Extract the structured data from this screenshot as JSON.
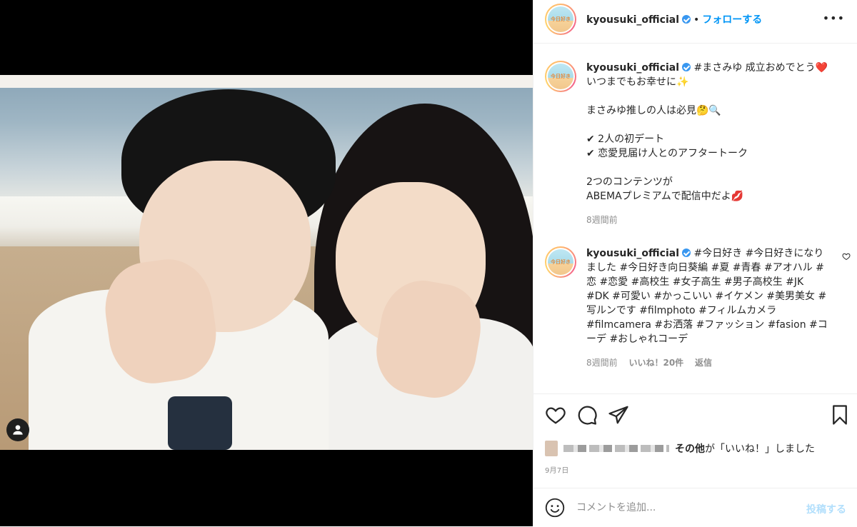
{
  "header": {
    "username": "kyousuki_official",
    "dot": "•",
    "follow_label": "フォローする",
    "more": "•••",
    "avatar_text": "今日好き"
  },
  "caption": {
    "username": "kyousuki_official",
    "lines": [
      "#まさみゆ 成立おめでとう❤️",
      "いつまでもお幸せに✨",
      "",
      "まさみゆ推しの人は必見🤔🔍",
      "",
      "✔︎ 2人の初デート",
      "✔︎ 恋愛見届け人とのアフタートーク",
      "",
      "2つのコンテンツが",
      "ABEMAプレミアムで配信中だよ💋"
    ],
    "time": "8週間前"
  },
  "hashtag_comment": {
    "username": "kyousuki_official",
    "text": "#今日好き #今日好きになりました #今日好き向日葵編 #夏 #青春 #アオハル #恋 #恋愛 #高校生 #女子高生 #男子高校生 #JK #DK #可愛い #かっこいい #イケメン #美男美女 #写ルンです #filmphoto #フィルムカメラ #filmcamera #お洒落 #ファッション #fasion #コーデ #おしゃれコーデ",
    "time": "8週間前",
    "likes": "いいね！20件",
    "reply": "返信"
  },
  "likes_line": {
    "bold": "その他",
    "rest": "が「いいね！」しました"
  },
  "date": "9月7日",
  "comment_box": {
    "placeholder": "コメントを追加...",
    "post_label": "投稿する"
  },
  "icons": {
    "like": "heart-icon",
    "comment": "comment-icon",
    "share": "share-icon",
    "save": "bookmark-icon",
    "emoji": "emoji-icon",
    "user_tag": "user-icon"
  },
  "colors": {
    "accent": "#0095f6",
    "verified": "#3897f0",
    "muted": "#8e8e8e",
    "post_disabled": "#b2dffc"
  }
}
